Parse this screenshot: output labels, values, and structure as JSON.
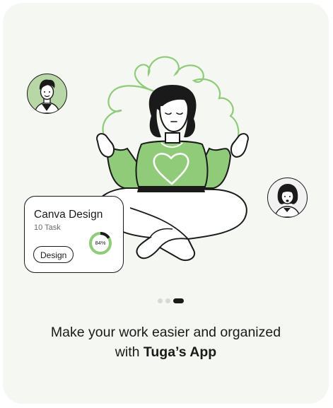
{
  "card": {
    "title": "Canva Design",
    "task_count": "10 Task",
    "chip_label": "Design",
    "progress_label": "84%",
    "progress_value": 0.84
  },
  "pager": {
    "total": 3,
    "active_index": 2
  },
  "headline": {
    "line1": "Make your work easier and organized",
    "line2_prefix": "with ",
    "app_name": "Tuga’s App"
  },
  "colors": {
    "accent_green": "#8fcb79",
    "light_green": "#b7d8a6",
    "background": "#f4f7f2",
    "ink": "#1a1a1a"
  },
  "icons": {
    "avatar_left": "man-avatar",
    "avatar_right": "woman-avatar",
    "illustration": "meditating-woman-illustration"
  }
}
